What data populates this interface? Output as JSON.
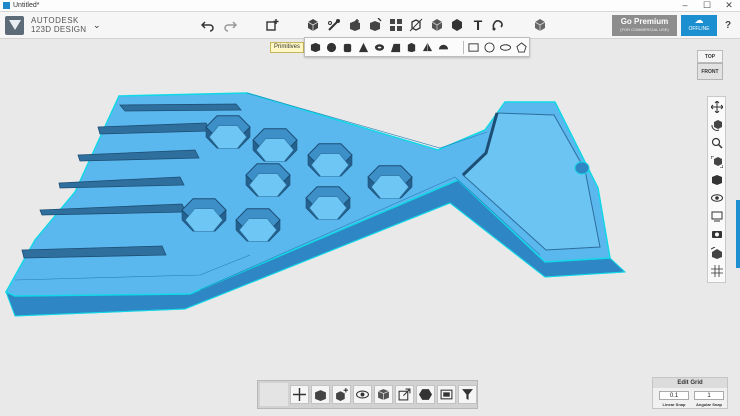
{
  "window": {
    "title": "Untitled*",
    "minimize": "–",
    "maximize": "☐",
    "close": "✕"
  },
  "brand": {
    "line1": "AUTODESK",
    "line2": "123D DESIGN",
    "menu_chevron": "⌄"
  },
  "toolbar": {
    "undo_icon": "undo-icon",
    "redo_icon": "redo-icon",
    "tools": [
      "primitives-icon",
      "sketch-icon",
      "construct-icon",
      "modify-icon",
      "pattern-icon",
      "grouping-icon",
      "combine-icon",
      "measure-icon",
      "text-icon",
      "snap-icon",
      "material-icon"
    ]
  },
  "premium": {
    "title": "Go Premium",
    "subtitle": "(FOR COMMERCIAL USE)"
  },
  "account": {
    "label": "OFFLINE"
  },
  "help": "?",
  "tooltip": "Primitives",
  "primitives": {
    "solids": [
      "box",
      "sphere",
      "cylinder",
      "cone",
      "torus",
      "wedge",
      "prism",
      "pyramid",
      "hemisphere"
    ],
    "sketches": [
      "rectangle",
      "circle",
      "ellipse",
      "polygon"
    ]
  },
  "viewcube": {
    "top": "TOP",
    "front": "FRONT"
  },
  "nav": [
    "pan-icon",
    "orbit-icon",
    "zoom-icon",
    "fit-icon",
    "view-mode-icon",
    "visibility-icon",
    "material-display-icon",
    "screenshot-icon",
    "grid-icon",
    "snap-icon"
  ],
  "bottom": [
    "move-icon",
    "smart-scale-icon",
    "smart-rotate-icon",
    "visibility-icon",
    "material-icon",
    "export-icon",
    "shape-icon",
    "group-icon",
    "filter-icon"
  ],
  "grid": {
    "title": "Edit Grid",
    "linear_snap_value": "0.1",
    "angular_snap_value": "1",
    "linear_snap_label": "Linear Snap",
    "angular_snap_label": "Angular Snap"
  },
  "colors": {
    "model": "#5bb8ef",
    "model_dark": "#2f86c4",
    "edge": "#12d7e6",
    "accent": "#1c8fd0"
  }
}
